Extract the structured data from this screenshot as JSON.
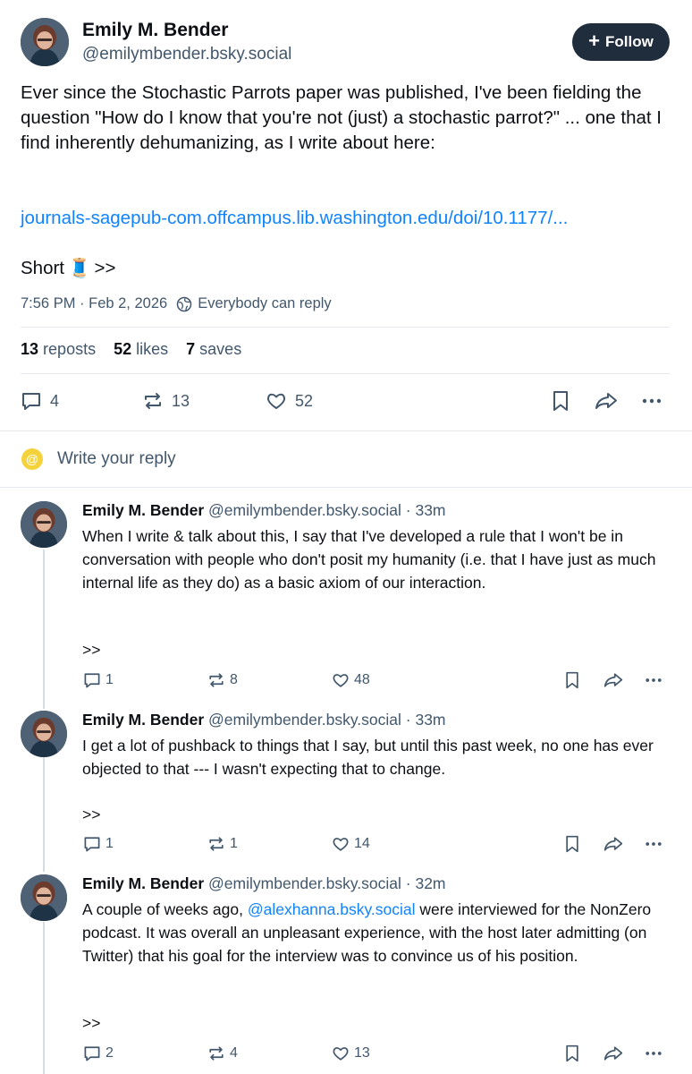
{
  "main_post": {
    "author_name": "Emily M. Bender",
    "author_handle": "@emilymbender.bsky.social",
    "follow_label": "Follow",
    "text": "Ever since the Stochastic Parrots paper was published, I've been fielding the question \"How do I know that you're not (just) a stochastic parrot?\" ... one that I find inherently dehumanizing, as I write about here:",
    "link": "journals-sagepub-com.offcampus.lib.washington.edu/doi/10.1177/...",
    "short_label": "Short",
    "short_emoji": "🧵",
    "short_suffix": ">>",
    "timestamp": "7:56 PM · Feb 2, 2026",
    "reply_setting": "Everybody can reply",
    "stats": {
      "reposts_count": "13",
      "reposts_label": "reposts",
      "likes_count": "52",
      "likes_label": "likes",
      "saves_count": "7",
      "saves_label": "saves"
    },
    "actions": {
      "replies": "4",
      "reposts": "13",
      "likes": "52"
    }
  },
  "compose": {
    "placeholder": "Write your reply",
    "icon": "at-icon"
  },
  "replies": [
    {
      "author_name": "Emily M. Bender",
      "author_handle": "@emilymbender.bsky.social",
      "time": "· 33m",
      "text": "When I write & talk about this, I say that I've developed a rule that I won't be in conversation with people who don't posit my humanity (i.e. that I have just as much internal life as they do) as a basic axiom of our interaction.",
      "continuation": ">>",
      "replies": "1",
      "reposts": "8",
      "likes": "48"
    },
    {
      "author_name": "Emily M. Bender",
      "author_handle": "@emilymbender.bsky.social",
      "time": "· 33m",
      "text": "I get a lot of pushback to things that I say, but until this past week, no one has ever objected to that --- I wasn't expecting that to change.",
      "continuation": ">>",
      "replies": "1",
      "reposts": "1",
      "likes": "14"
    },
    {
      "author_name": "Emily M. Bender",
      "author_handle": "@emilymbender.bsky.social",
      "time": "· 32m",
      "text_before": "A couple of weeks ago, ",
      "mention": "@alexhanna.bsky.social",
      "text_after": " were interviewed for the NonZero podcast. It was overall an unpleasant experience, with the host later admitting (on Twitter) that his goal for the interview was to convince us of his position.",
      "continuation": ">>",
      "replies": "2",
      "reposts": "4",
      "likes": "13"
    }
  ],
  "colors": {
    "link": "#1083fe",
    "muted": "#42576c",
    "follow_bg": "#1f2d3d",
    "divider": "#e3e8ee"
  }
}
